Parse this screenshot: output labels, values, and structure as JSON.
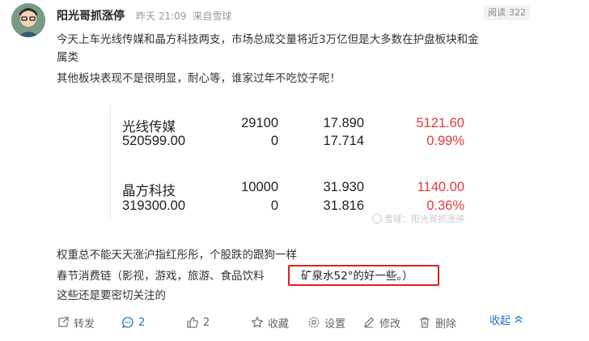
{
  "author": {
    "name": "阳光哥抓涨停",
    "time": "昨天 21:09",
    "source": "来自雪球"
  },
  "read_badge": {
    "label": "阅读",
    "count": "322"
  },
  "post": {
    "line1": "今天上车光线传媒和晶方科技两支，市场总成交量将近3万亿但是大多数在护盘板块和金",
    "line2": "属类",
    "line3": "其他板块表现不是很明显，耐心等，谁家过年不吃饺子呢！",
    "line4": "权重总不能天天涨沪指红彤彤，个股跌的跟狗一样",
    "line5": "春节消费链（影视，游戏，旅游、食品饮料",
    "line5_highlight": "矿泉水52°的好一些。）",
    "line6": "这些还是要密切关注的"
  },
  "stocks": [
    {
      "name": "光线传媒",
      "qty": "29100",
      "price": "17.890",
      "pnl": "5121.60"
    },
    {
      "name": "520599.00",
      "qty": "0",
      "price": "17.714",
      "pnl": "0.99%"
    },
    {
      "name": "晶方科技",
      "qty": "10000",
      "price": "31.930",
      "pnl": "1140.00"
    },
    {
      "name": "319300.00",
      "qty": "0",
      "price": "31.816",
      "pnl": "0.36%"
    }
  ],
  "watermark": "雪球：阳光哥抓涨停",
  "actions": {
    "forward": "转发",
    "comment": "2",
    "like": "2",
    "favorite": "收藏",
    "settings": "设置",
    "edit": "修改",
    "delete": "删除",
    "collapse": "收起"
  },
  "colors": {
    "accent_blue": "#1f6fd1",
    "loss_red": "#e5393e",
    "highlight_border": "#e31e1e"
  }
}
